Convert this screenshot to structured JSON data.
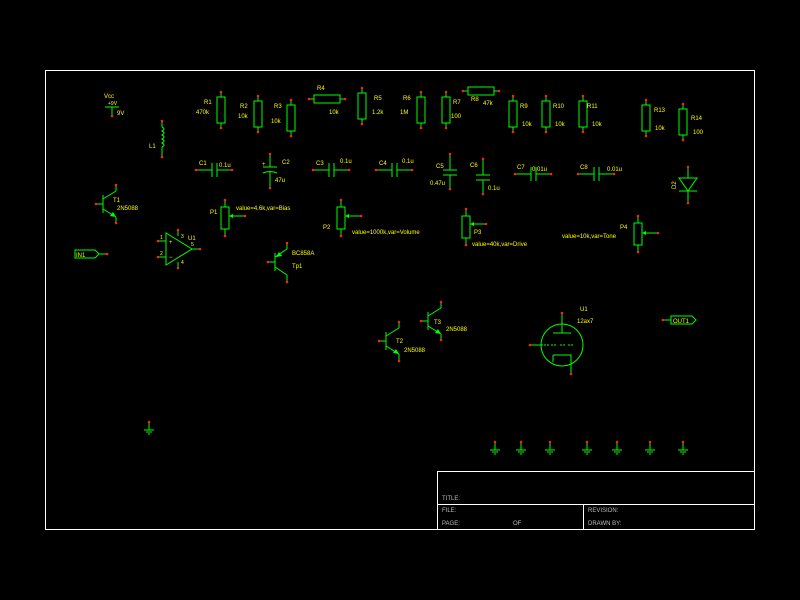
{
  "title_block": {
    "title_label": "TITLE:",
    "file_label": "FILE:",
    "revision_label": "REVISION:",
    "page_label": "PAGE:",
    "of_label": "OF",
    "drawn_by_label": "DRAWN BY:"
  },
  "power": {
    "name": "Vcc",
    "voltage_label": "+9V",
    "value": "9V"
  },
  "resistors": [
    {
      "ref": "R1",
      "value": "470k"
    },
    {
      "ref": "R2",
      "value": "10k"
    },
    {
      "ref": "R3",
      "value": "10k"
    },
    {
      "ref": "R4",
      "value": "10k"
    },
    {
      "ref": "R5",
      "value": "1.2k"
    },
    {
      "ref": "R6",
      "value": "1M"
    },
    {
      "ref": "R7",
      "value": "100"
    },
    {
      "ref": "R8",
      "value": "47k"
    },
    {
      "ref": "R9",
      "value": "10k"
    },
    {
      "ref": "R10",
      "value": "10k"
    },
    {
      "ref": "R11",
      "value": "10k"
    },
    {
      "ref": "R13",
      "value": "10k"
    },
    {
      "ref": "R14",
      "value": "100"
    }
  ],
  "capacitors": [
    {
      "ref": "C1",
      "value": "0.1u"
    },
    {
      "ref": "C2",
      "value": "47u"
    },
    {
      "ref": "C3",
      "value": "0.1u"
    },
    {
      "ref": "C4",
      "value": "0.1u"
    },
    {
      "ref": "C5",
      "value": "0.47u"
    },
    {
      "ref": "C6",
      "value": "0.1u"
    },
    {
      "ref": "C7",
      "value": "0.01u"
    },
    {
      "ref": "C8",
      "value": "0.01u"
    }
  ],
  "inductor": {
    "ref": "L1"
  },
  "diode": {
    "ref": "D2"
  },
  "potentiometers": [
    {
      "ref": "P1",
      "value": "value=4.6k,var=Bias"
    },
    {
      "ref": "P2",
      "value": "value=1000k,var=Volume"
    },
    {
      "ref": "P3",
      "value": "value=40k,var=Drive"
    },
    {
      "ref": "P4",
      "value": "value=10k,var=Tone"
    }
  ],
  "transistors": [
    {
      "ref": "T1",
      "value": "2N5088"
    },
    {
      "ref": "T2",
      "value": "2N5088"
    },
    {
      "ref": "T3",
      "value": "2N5088"
    },
    {
      "ref": "Tp1",
      "value": "BC858A"
    }
  ],
  "opamp": {
    "ref": "U1",
    "pins": [
      "1",
      "2",
      "3",
      "4",
      "5"
    ]
  },
  "tube": {
    "ref": "U1",
    "value": "12ax7"
  },
  "ports": {
    "input": "IN1",
    "output": "OUT1"
  }
}
